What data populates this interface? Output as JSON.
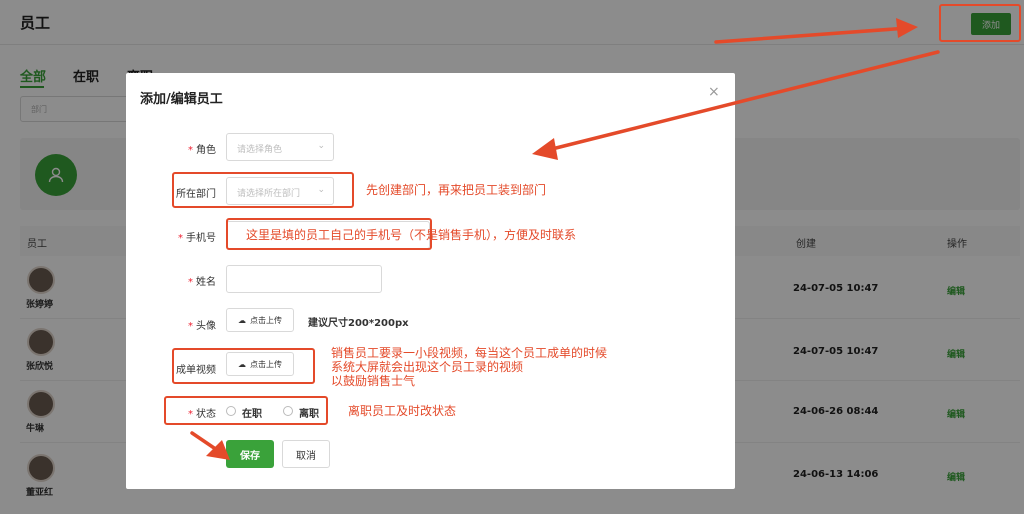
{
  "page": {
    "title": "员工",
    "add_button": "添加",
    "tabs": [
      "全部",
      "在职",
      "离职"
    ],
    "dept_placeholder": "部门",
    "columns": {
      "employee": "员工",
      "created": "创建",
      "actions": "操作"
    },
    "employees": [
      {
        "name": "张婷婷",
        "created": "24-07-05 10:47",
        "action": "编辑"
      },
      {
        "name": "张欣悦",
        "created": "24-07-05 10:47",
        "action": "编辑"
      },
      {
        "name": "牛琳",
        "created": "24-06-26 08:44",
        "action": "编辑"
      },
      {
        "name": "董亚红",
        "created": "24-06-13 14:06",
        "action": "编辑"
      }
    ]
  },
  "modal": {
    "title": "添加/编辑员工",
    "close": "×",
    "fields": {
      "role": {
        "label": "角色",
        "placeholder": "请选择角色"
      },
      "dept": {
        "label": "所在部门",
        "placeholder": "请选择所在部门"
      },
      "phone": {
        "label": "手机号"
      },
      "name": {
        "label": "姓名"
      },
      "avatar": {
        "label": "头像",
        "upload": "点击上传",
        "hint": "建议尺寸200*200px"
      },
      "video": {
        "label": "成单视频",
        "upload": "点击上传"
      },
      "status": {
        "label": "状态",
        "options": [
          "在职",
          "离职"
        ]
      }
    },
    "save": "保存",
    "cancel": "取消"
  },
  "annotations": {
    "dept_note": "先创建部门，再来把员工装到部门",
    "phone_note": "这里是填的员工自己的手机号（不是销售手机），方便及时联系",
    "video_note": [
      "销售员工要录一小段视频，每当这个员工成单的时候",
      "系统大屏就会出现这个员工录的视频",
      "以鼓励销售士气"
    ],
    "status_note": "离职员工及时改状态",
    "color": "#e44a2a"
  },
  "colors": {
    "accent": "#3aa23a",
    "required": "#e23333"
  }
}
